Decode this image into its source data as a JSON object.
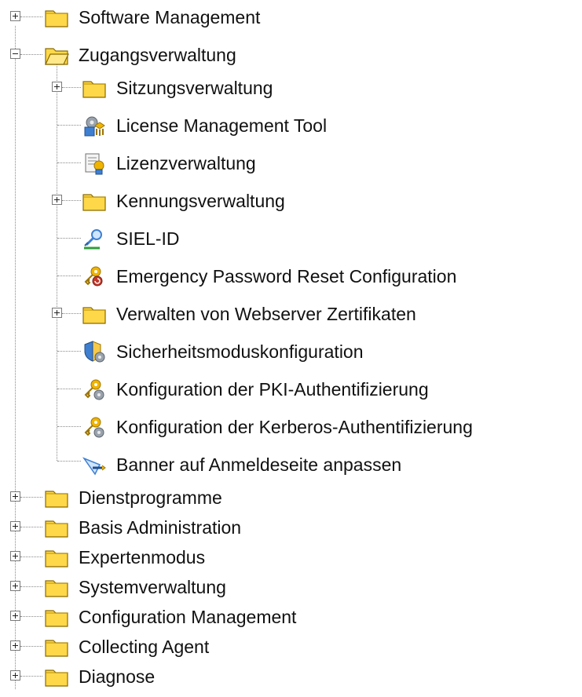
{
  "tree": {
    "items": [
      {
        "label": "Software Management",
        "icon": "folder-icon",
        "state": "collapsed"
      },
      {
        "label": "Zugangsverwaltung",
        "icon": "folder-open-icon",
        "state": "expanded"
      },
      {
        "label": "Sitzungsverwaltung",
        "icon": "folder-icon",
        "state": "collapsed"
      },
      {
        "label": "License Management Tool",
        "icon": "license-tool-icon",
        "state": "leaf"
      },
      {
        "label": "Lizenzverwaltung",
        "icon": "license-certificate-icon",
        "state": "leaf"
      },
      {
        "label": "Kennungsverwaltung",
        "icon": "folder-icon",
        "state": "collapsed"
      },
      {
        "label": "SIEL-ID",
        "icon": "user-id-icon",
        "state": "leaf"
      },
      {
        "label": "Emergency Password Reset Configuration",
        "icon": "key-reset-icon",
        "state": "leaf"
      },
      {
        "label": "Verwalten von Webserver Zertifikaten",
        "icon": "folder-icon",
        "state": "collapsed"
      },
      {
        "label": "Sicherheitsmoduskonfiguration",
        "icon": "shield-gear-icon",
        "state": "leaf"
      },
      {
        "label": "Konfiguration der PKI-Authentifizierung",
        "icon": "key-gear-icon",
        "state": "leaf"
      },
      {
        "label": "Konfiguration der Kerberos-Authentifizierung",
        "icon": "key-gear-icon",
        "state": "leaf"
      },
      {
        "label": "Banner auf Anmeldeseite anpassen",
        "icon": "banner-edit-icon",
        "state": "leaf"
      },
      {
        "label": "Dienstprogramme",
        "icon": "folder-icon",
        "state": "collapsed"
      },
      {
        "label": "Basis Administration",
        "icon": "folder-icon",
        "state": "collapsed"
      },
      {
        "label": "Expertenmodus",
        "icon": "folder-icon",
        "state": "collapsed"
      },
      {
        "label": "Systemverwaltung",
        "icon": "folder-icon",
        "state": "collapsed"
      },
      {
        "label": "Configuration Management",
        "icon": "folder-icon",
        "state": "collapsed"
      },
      {
        "label": "Collecting Agent",
        "icon": "folder-icon",
        "state": "collapsed"
      },
      {
        "label": "Diagnose",
        "icon": "folder-icon",
        "state": "collapsed"
      }
    ]
  },
  "colors": {
    "folder_fill": "#ffd84a",
    "folder_stroke": "#8a6a00",
    "gear": "#9aa3ad",
    "key_gold": "#f0b400",
    "badge_red": "#c0392b",
    "blue": "#3f7fd0"
  }
}
